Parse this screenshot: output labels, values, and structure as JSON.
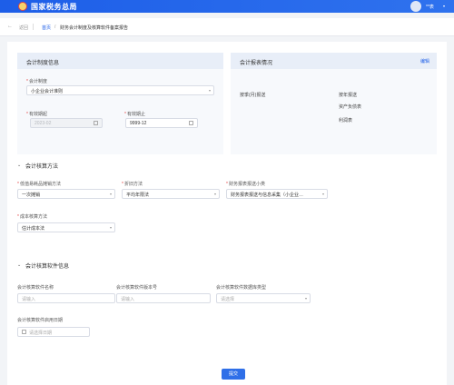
{
  "header": {
    "site_title": "国家税务总局",
    "user_name": "**表"
  },
  "nav": {
    "back_label": "返回",
    "crumb_home": "首页",
    "crumb_sep": "/",
    "crumb_current": "财务会计制度及核算软件备案报告"
  },
  "system_card": {
    "title": "会计制度信息",
    "system_label": "会计制度",
    "system_value": "小企业会计准则",
    "start_label": "有效期起",
    "start_value": "2023-02",
    "end_label": "有效期止",
    "end_value": "9999-12"
  },
  "report_card": {
    "title": "会计报表情况",
    "edit_label": "编辑",
    "period_label": "按季(月)报送",
    "annual_label": "按年报送",
    "items": [
      "资产负债表",
      "利润表"
    ]
  },
  "method_section": {
    "title": "会计核算方法",
    "low_value_label": "低值易耗品摊销方法",
    "low_value_value": "一次摊销",
    "depreciation_label": "折旧方法",
    "depreciation_value": "平均年限法",
    "report_category_label": "财务报表报送小类",
    "report_category_value": "财务报表报送与信息采集（小企业…",
    "cost_label": "成本核算方法",
    "cost_value": "估计成本法"
  },
  "software_section": {
    "title": "会计核算软件信息",
    "name_label": "会计核算软件名称",
    "name_placeholder": "请输入",
    "version_label": "会计核算软件版本号",
    "version_placeholder": "请输入",
    "db_type_label": "会计核算软件数据库类型",
    "db_type_placeholder": "请选择",
    "date_label": "会计核算软件启用日期",
    "date_placeholder": "请选择日期"
  },
  "submit_label": "提交",
  "colors": {
    "brand": "#1d5ee8",
    "required": "#e54545",
    "submit": "#2f6fe8"
  }
}
